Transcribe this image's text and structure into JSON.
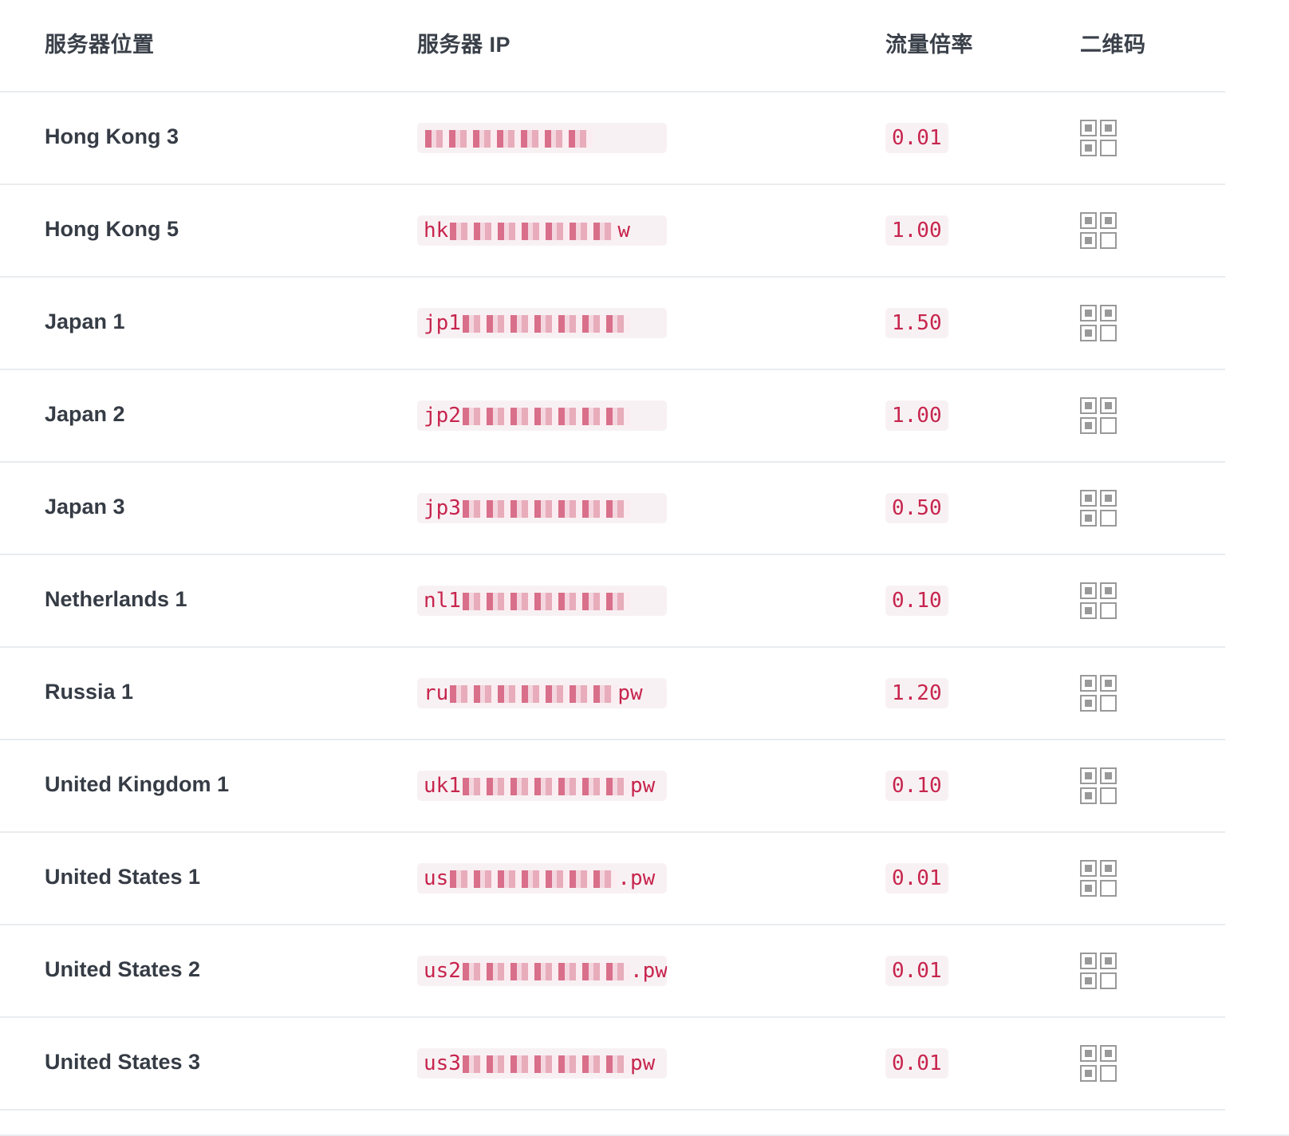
{
  "header": {
    "location": "服务器位置",
    "ip": "服务器 IP",
    "rate": "流量倍率",
    "qrcode": "二维码"
  },
  "rows": [
    {
      "location": "Hong Kong 3",
      "ip_prefix": "",
      "ip_suffix": "",
      "rate": "0.01",
      "icon": "qr-code-icon"
    },
    {
      "location": "Hong Kong 5",
      "ip_prefix": "hk",
      "ip_suffix": "w",
      "rate": "1.00",
      "icon": "qr-code-icon"
    },
    {
      "location": "Japan 1",
      "ip_prefix": "jp1",
      "ip_suffix": "",
      "rate": "1.50",
      "icon": "qr-code-icon"
    },
    {
      "location": "Japan 2",
      "ip_prefix": "jp2",
      "ip_suffix": "",
      "rate": "1.00",
      "icon": "qr-code-icon"
    },
    {
      "location": "Japan 3",
      "ip_prefix": "jp3",
      "ip_suffix": "",
      "rate": "0.50",
      "icon": "qr-code-icon"
    },
    {
      "location": "Netherlands 1",
      "ip_prefix": "nl1",
      "ip_suffix": "",
      "rate": "0.10",
      "icon": "qr-code-icon"
    },
    {
      "location": "Russia 1",
      "ip_prefix": "ru",
      "ip_suffix": "pw",
      "rate": "1.20",
      "icon": "qr-code-icon"
    },
    {
      "location": "United Kingdom 1",
      "ip_prefix": "uk1",
      "ip_suffix": "pw",
      "rate": "0.10",
      "icon": "qr-code-icon"
    },
    {
      "location": "United States 1",
      "ip_prefix": "us",
      "ip_suffix": ".pw",
      "rate": "0.01",
      "icon": "qr-code-icon"
    },
    {
      "location": "United States 2",
      "ip_prefix": "us2",
      "ip_suffix": ".pw",
      "rate": "0.01",
      "icon": "qr-code-icon"
    },
    {
      "location": "United States 3",
      "ip_prefix": "us3",
      "ip_suffix": "pw",
      "rate": "0.01",
      "icon": "qr-code-icon"
    }
  ],
  "colors": {
    "code_text": "#c7254e",
    "code_bg": "#f8f1f3",
    "border": "#e9ecef",
    "icon": "#999999"
  }
}
